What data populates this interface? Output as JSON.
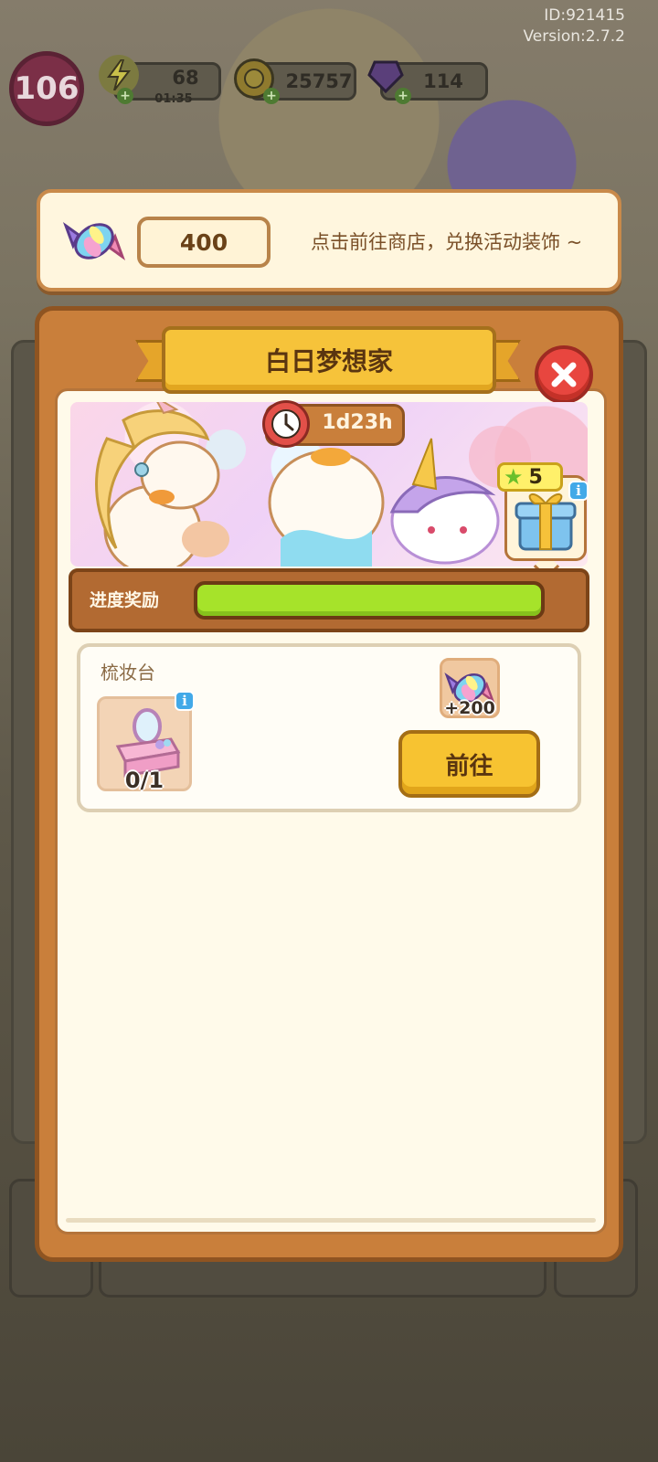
{
  "meta": {
    "id": "ID:921415",
    "version": "Version:2.7.2"
  },
  "hud": {
    "level": "106",
    "energy": "68",
    "energy_timer": "01:35",
    "coins": "25757",
    "gems": "114"
  },
  "banner": {
    "candy_count": "400",
    "hint": "点击前往商店，兑换活动装饰 ~"
  },
  "event": {
    "title": "白日梦想家",
    "timer": "1d23h",
    "reward_stars": "5",
    "info_icon": "i",
    "progress_label": "进度奖励",
    "progress_fraction": 1.0
  },
  "task": {
    "name": "梳妆台",
    "progress": "0/1",
    "reward": "+200",
    "go_label": "前往",
    "info_icon": "i"
  },
  "colors": {
    "panel": "#c97f3b",
    "progress_fill": "#a6e32a",
    "button": "#f7c331",
    "close": "#e8463f"
  }
}
